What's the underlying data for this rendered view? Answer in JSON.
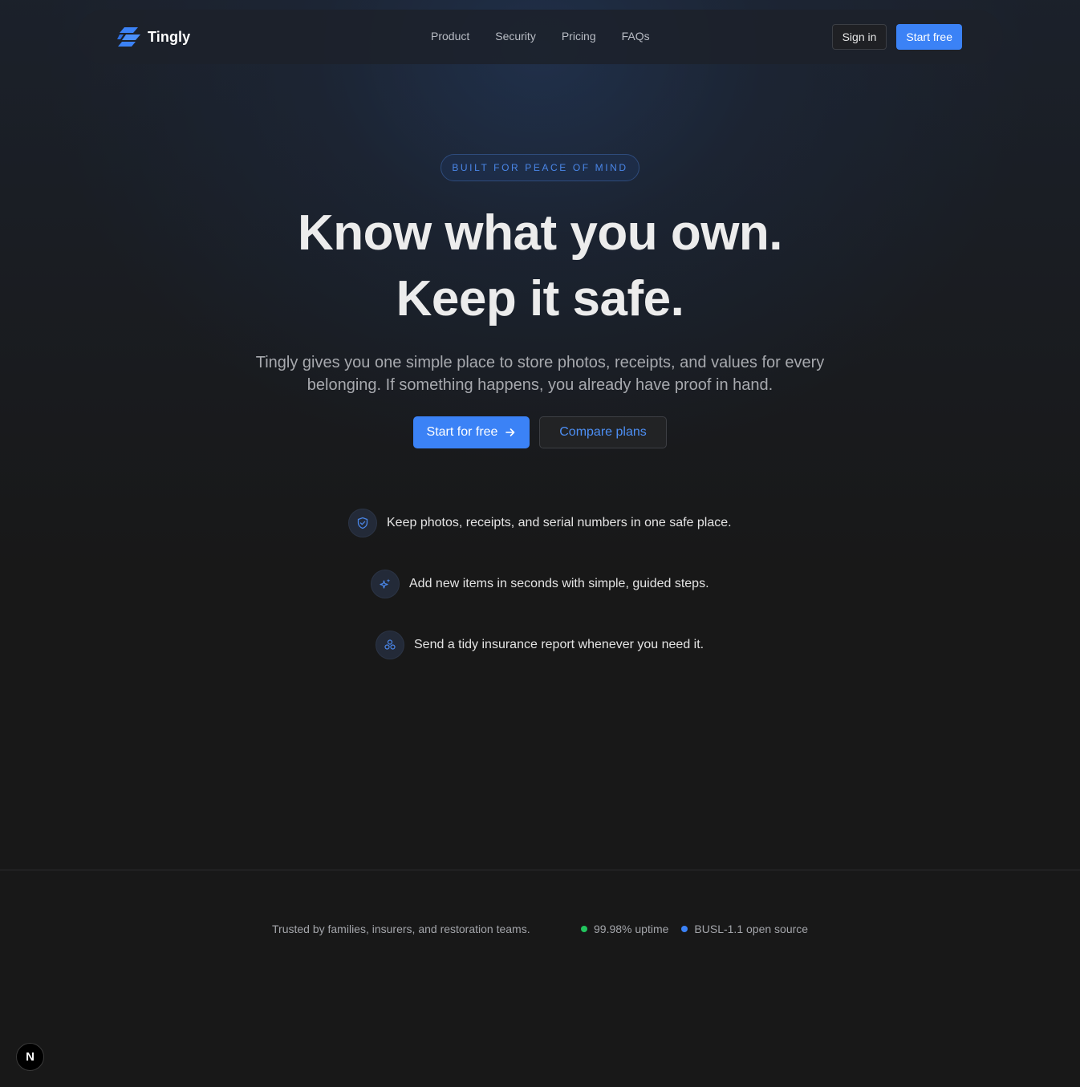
{
  "nav": {
    "brand": "Tingly",
    "links": [
      {
        "label": "Product"
      },
      {
        "label": "Security"
      },
      {
        "label": "Pricing"
      },
      {
        "label": "FAQs"
      }
    ],
    "signin_label": "Sign in",
    "start_label": "Start free"
  },
  "hero": {
    "badge": "BUILT FOR PEACE OF MIND",
    "headline_line1": "Know what you own.",
    "headline_line2": "Keep it safe.",
    "subtext": "Tingly gives you one simple place to store photos, receipts, and values for every belonging. If something happens, you already have proof in hand.",
    "primary_cta": "Start for free",
    "secondary_cta": "Compare plans"
  },
  "features": [
    {
      "icon": "shield-check-icon",
      "text": "Keep photos, receipts, and serial numbers in one safe place."
    },
    {
      "icon": "sparkles-icon",
      "text": "Add new items in seconds with simple, guided steps."
    },
    {
      "icon": "nodes-icon",
      "text": "Send a tidy insurance report whenever you need it."
    }
  ],
  "footer": {
    "trusted": "Trusted by families, insurers, and restoration teams.",
    "stats": [
      {
        "label": "99.98% uptime",
        "color": "#22c55e"
      },
      {
        "label": "BUSL-1.1 open source",
        "color": "#3b82f6"
      }
    ]
  },
  "dev_badge": "N",
  "colors": {
    "accent": "#3b82f6",
    "background": "#181818"
  }
}
